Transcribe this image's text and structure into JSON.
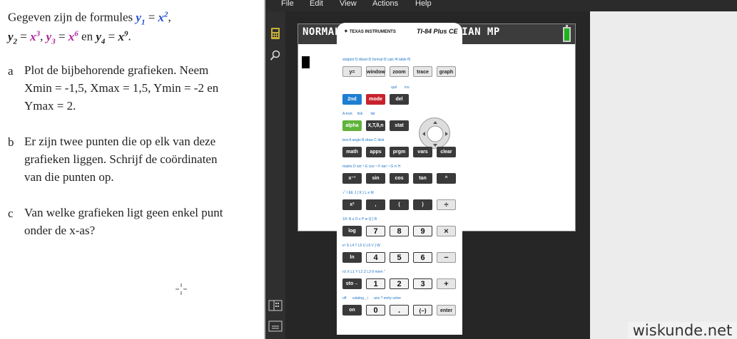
{
  "exercise": {
    "intro_prefix": "Gegeven zijn de formules",
    "and_word": "en",
    "parts": [
      {
        "letter": "a",
        "lines": [
          "Plot de bijbehorende grafieken. Neem",
          "Xmin = -1,5, Xmax = 1,5, Ymin = -2 en",
          "Ymax = 2."
        ]
      },
      {
        "letter": "b",
        "lines": [
          "Er zijn twee punten die op elk van deze",
          "grafieken liggen. Schrijf de coördinaten",
          "van die punten op."
        ]
      },
      {
        "letter": "c",
        "lines": [
          "Van welke grafieken ligt geen enkel punt",
          "onder de x-as?"
        ]
      }
    ]
  },
  "menu": [
    "File",
    "Edit",
    "View",
    "Actions",
    "Help"
  ],
  "screen": {
    "status": "NORMAL FIX2 AUTO REAL RADIAN MP"
  },
  "calculator": {
    "brand": "Texas Instruments",
    "model": "TI-84 Plus CE",
    "colors": {
      "blue_2nd": "#1e7fd1",
      "red_mode": "#c8232c",
      "green_alpha": "#5fb33a",
      "battery": "#1db31d"
    }
  },
  "watermark": "wiskunde.net"
}
